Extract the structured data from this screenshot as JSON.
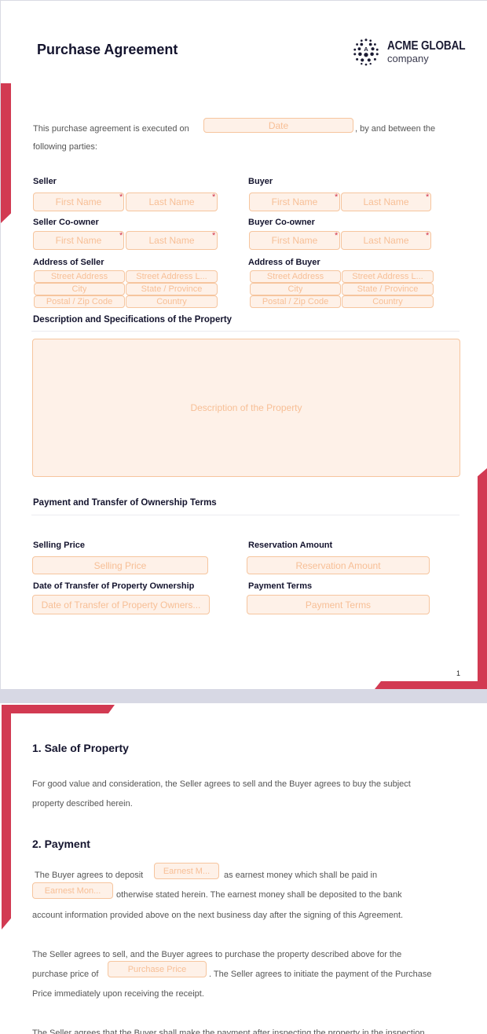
{
  "document": {
    "title": "Purchase Agreement",
    "logo": {
      "name": "ACME GLOBAL",
      "sub": "company",
      "icon": "globe-dots-icon"
    },
    "intro": {
      "before": "This purchase agreement is executed on",
      "date_placeholder": "Date",
      "after": ", by and between the",
      "line2": "following parties:"
    },
    "parties": {
      "seller": {
        "label": "Seller",
        "first": "First Name",
        "last": "Last Name"
      },
      "buyer": {
        "label": "Buyer",
        "first": "First Name",
        "last": "Last Name"
      },
      "seller_coowner": {
        "label": "Seller Co-owner",
        "first": "First Name",
        "last": "Last Name"
      },
      "buyer_coowner": {
        "label": "Buyer Co-owner",
        "first": "First Name",
        "last": "Last Name"
      },
      "required_mark": "*"
    },
    "address": {
      "seller_label": "Address of Seller",
      "buyer_label": "Address of Buyer",
      "fields": {
        "street": "Street Address",
        "street2": "Street Address L...",
        "city": "City",
        "state": "State / Province",
        "zip": "Postal / Zip Code",
        "country": "Country"
      }
    },
    "description": {
      "heading": "Description and Specifications of the Property",
      "placeholder": "Description of the Property"
    },
    "payment_terms": {
      "heading": "Payment and Transfer of Ownership Terms",
      "selling_price_label": "Selling Price",
      "selling_price_placeholder": "Selling Price",
      "reservation_label": "Reservation Amount",
      "reservation_placeholder": "Reservation Amount",
      "transfer_date_label": "Date of Transfer of Property Ownership",
      "transfer_date_placeholder": "Date of Transfer of Property Owners...",
      "payment_terms_label": "Payment Terms",
      "payment_terms_placeholder": "Payment Terms"
    },
    "page1_number": "1",
    "section1": {
      "heading": "1. Sale of Property",
      "text_line1": "For good value and consideration, the Seller agrees to sell and the Buyer agrees to buy the subject",
      "text_line2": "property described herein."
    },
    "section2": {
      "heading": "2. Payment",
      "p1_a": "The Buyer agrees to deposit",
      "p1_field1": "Earnest M...",
      "p1_b": "as earnest money which shall be paid in",
      "p1_field2": "Earnest Mon...",
      "p1_c": "otherwise stated herein. The earnest money shall be deposited to the bank",
      "p1_d": "account information provided above on the next business day after the signing of this Agreement.",
      "p2_a": "The Seller agrees to sell, and the Buyer agrees to purchase the property described above for the",
      "p2_b": "purchase price of",
      "p2_field": "Purchase Price",
      "p2_c": ". The Seller agrees to initiate the payment of the Purchase",
      "p2_d": "Price immediately upon receiving the receipt.",
      "p3_a": "The Seller agrees that the Buyer shall make the payment after inspecting the property in the inspection"
    }
  }
}
